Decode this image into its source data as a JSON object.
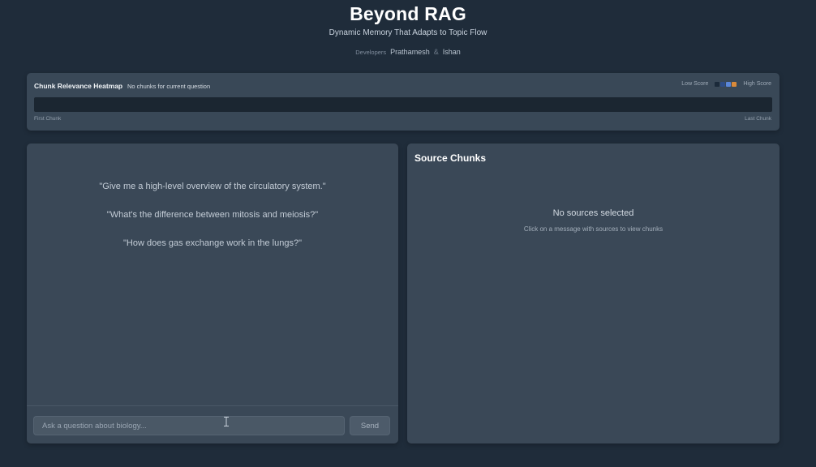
{
  "header": {
    "title": "Beyond RAG",
    "subtitle": "Dynamic Memory That Adapts to Topic Flow",
    "developers_label": "Developers",
    "developer_1": "Prathamesh",
    "separator": "&",
    "developer_2": "Ishan"
  },
  "heatmap": {
    "title": "Chunk Relevance Heatmap",
    "status": "No chunks for current question",
    "legend_low": "Low Score",
    "legend_high": "High Score",
    "legend_colors": [
      "#1b2a3a",
      "#2f4d86",
      "#5a86d8",
      "#d98a3a"
    ],
    "first_label": "First Chunk",
    "last_label": "Last Chunk"
  },
  "chat": {
    "suggestions": [
      "\"Give me a high-level overview of the circulatory system.\"",
      "\"What's the difference between mitosis and meiosis?\"",
      "\"How does gas exchange work in the lungs?\""
    ],
    "input_placeholder": "Ask a question about biology...",
    "send_label": "Send"
  },
  "sources": {
    "title": "Source Chunks",
    "empty_title": "No sources selected",
    "empty_hint": "Click on a message with sources to view chunks"
  }
}
